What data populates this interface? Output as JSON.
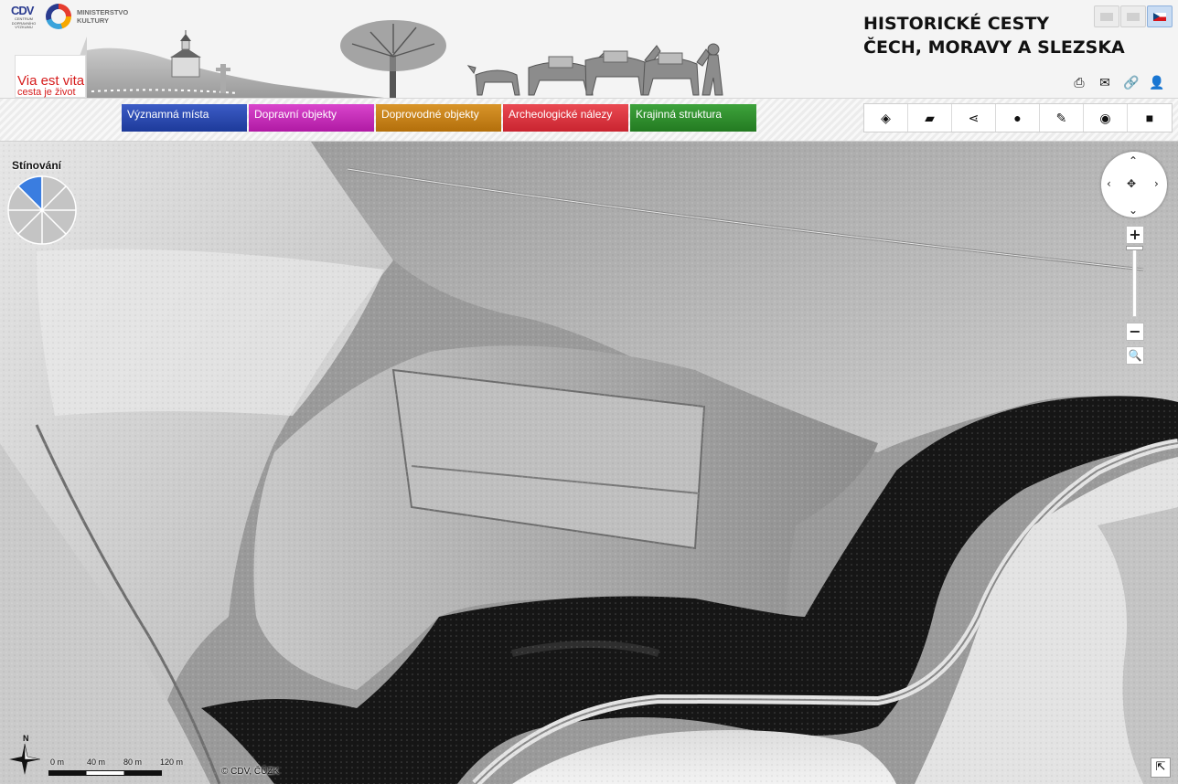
{
  "header": {
    "logo_cdv": {
      "mark": "CDV",
      "subtitle": "CENTRUM DOPRAVNÍHO VÝZKUMU"
    },
    "logo_mk": {
      "line1": "MINISTERSTVO",
      "line2": "KULTURY"
    },
    "title_line1": "HISTORICKÉ CESTY",
    "title_line2": "ČECH, MORAVY A SLEZSKA",
    "languages": [
      {
        "code": "other",
        "active": false
      },
      {
        "code": "en",
        "active": false
      },
      {
        "code": "cs",
        "active": true
      }
    ],
    "tools": [
      {
        "icon": "print-icon",
        "glyph": "⎙"
      },
      {
        "icon": "mail-icon",
        "glyph": "✉"
      },
      {
        "icon": "link-icon",
        "glyph": "🔗"
      },
      {
        "icon": "user-icon",
        "glyph": "👤"
      }
    ]
  },
  "brand": {
    "line1": "Via est vita",
    "line2": "cesta je život"
  },
  "categories": [
    {
      "label": "Významná místa",
      "color": "#2645a8"
    },
    {
      "label": "Dopravní objekty",
      "color": "#c52ab8"
    },
    {
      "label": "Doprovodné objekty",
      "color": "#c47d12"
    },
    {
      "label": "Archeologické nálezy",
      "color": "#d7303a"
    },
    {
      "label": "Krajinná struktura",
      "color": "#2d8b2b"
    }
  ],
  "toolbar": [
    {
      "icon": "layers-icon",
      "glyph": "◈"
    },
    {
      "icon": "map-icon",
      "glyph": "▰"
    },
    {
      "icon": "share-icon",
      "glyph": "⋖"
    },
    {
      "icon": "comment-icon",
      "glyph": "●"
    },
    {
      "icon": "measure-icon",
      "glyph": "✎"
    },
    {
      "icon": "camera-icon",
      "glyph": "◉"
    },
    {
      "icon": "video-icon",
      "glyph": "■"
    }
  ],
  "map": {
    "shading_label": "Stínování",
    "shading_active_color": "#3a7de0",
    "scale_labels": [
      "0 m",
      "40 m",
      "80 m",
      "120 m"
    ],
    "north_label": "N",
    "copyright": "© CDV, ČÚZK",
    "zoom_in": "+",
    "zoom_out": "−"
  }
}
